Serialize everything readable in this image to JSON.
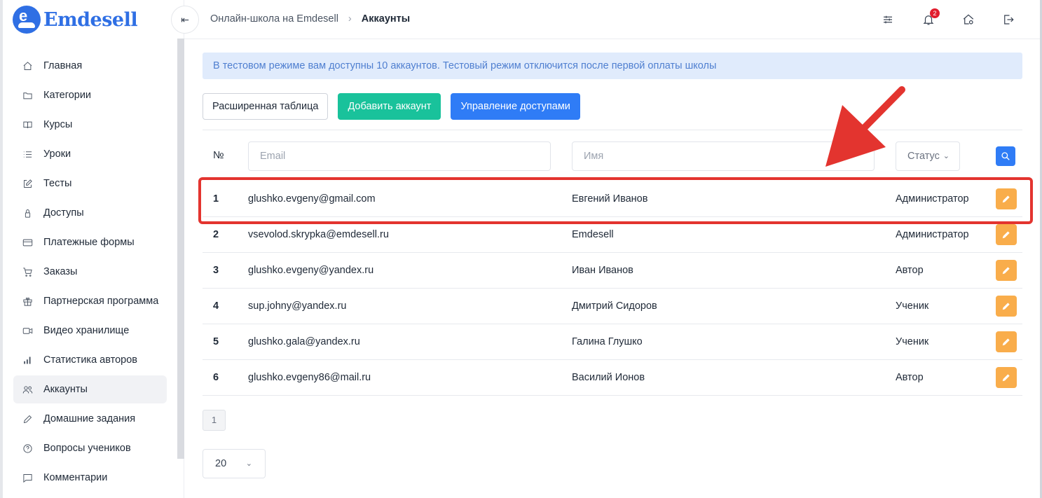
{
  "brand": {
    "name": "Emdesell",
    "logo_letter": "e",
    "color": "#2f6fe4"
  },
  "header": {
    "collapse_icon": "⇤",
    "breadcrumb": [
      "Онлайн-школа на Emdesell",
      "Аккаунты"
    ],
    "separator": "›",
    "notifications_count": "2",
    "icons": [
      "sliders-icon",
      "bell-icon",
      "home-settings-icon",
      "logout-icon"
    ]
  },
  "sidebar": {
    "items": [
      {
        "label": "Главная",
        "icon": "home-icon"
      },
      {
        "label": "Категории",
        "icon": "folder-icon"
      },
      {
        "label": "Курсы",
        "icon": "book-icon"
      },
      {
        "label": "Уроки",
        "icon": "list-icon"
      },
      {
        "label": "Тесты",
        "icon": "edit-square-icon"
      },
      {
        "label": "Доступы",
        "icon": "lock-icon"
      },
      {
        "label": "Платежные формы",
        "icon": "credit-card-icon"
      },
      {
        "label": "Заказы",
        "icon": "cart-icon"
      },
      {
        "label": "Партнерская программа",
        "icon": "gift-icon"
      },
      {
        "label": "Видео хранилище",
        "icon": "video-icon"
      },
      {
        "label": "Статистика авторов",
        "icon": "bar-chart-icon"
      },
      {
        "label": "Аккаунты",
        "icon": "users-icon",
        "active": true
      },
      {
        "label": "Домашние задания",
        "icon": "pencil-icon"
      },
      {
        "label": "Вопросы учеников",
        "icon": "question-icon"
      },
      {
        "label": "Комментарии",
        "icon": "comment-icon"
      }
    ]
  },
  "alert": {
    "text": "В тестовом режиме вам доступны 10 аккаунтов. Тестовый режим отключится после первой оплаты школы"
  },
  "toolbar": {
    "extended_table": "Расширенная таблица",
    "add_account": "Добавить аккаунт",
    "manage_access": "Управление доступами"
  },
  "filters": {
    "num_header": "№",
    "email_placeholder": "Email",
    "name_placeholder": "Имя",
    "status_placeholder": "Статус"
  },
  "accounts": [
    {
      "num": "1",
      "email": "glushko.evgeny@gmail.com",
      "name": "Евгений Иванов",
      "role": "Администратор"
    },
    {
      "num": "2",
      "email": "vsevolod.skrypka@emdesell.ru",
      "name": "Emdesell",
      "role": "Администратор"
    },
    {
      "num": "3",
      "email": "glushko.evgeny@yandex.ru",
      "name": "Иван Иванов",
      "role": "Автор"
    },
    {
      "num": "4",
      "email": "sup.johny@yandex.ru",
      "name": "Дмитрий Сидоров",
      "role": "Ученик"
    },
    {
      "num": "5",
      "email": "glushko.gala@yandex.ru",
      "name": "Галина Глушко",
      "role": "Ученик"
    },
    {
      "num": "6",
      "email": "glushko.evgeny86@mail.ru",
      "name": "Василий Ионов",
      "role": "Автор"
    }
  ],
  "pagination": {
    "current_page": "1"
  },
  "per_page": {
    "value": "20"
  },
  "colors": {
    "accent_blue": "#2f7cf6",
    "accent_green": "#19c29b",
    "edit_orange": "#f9ad4b",
    "annotation_red": "#e3342f"
  }
}
